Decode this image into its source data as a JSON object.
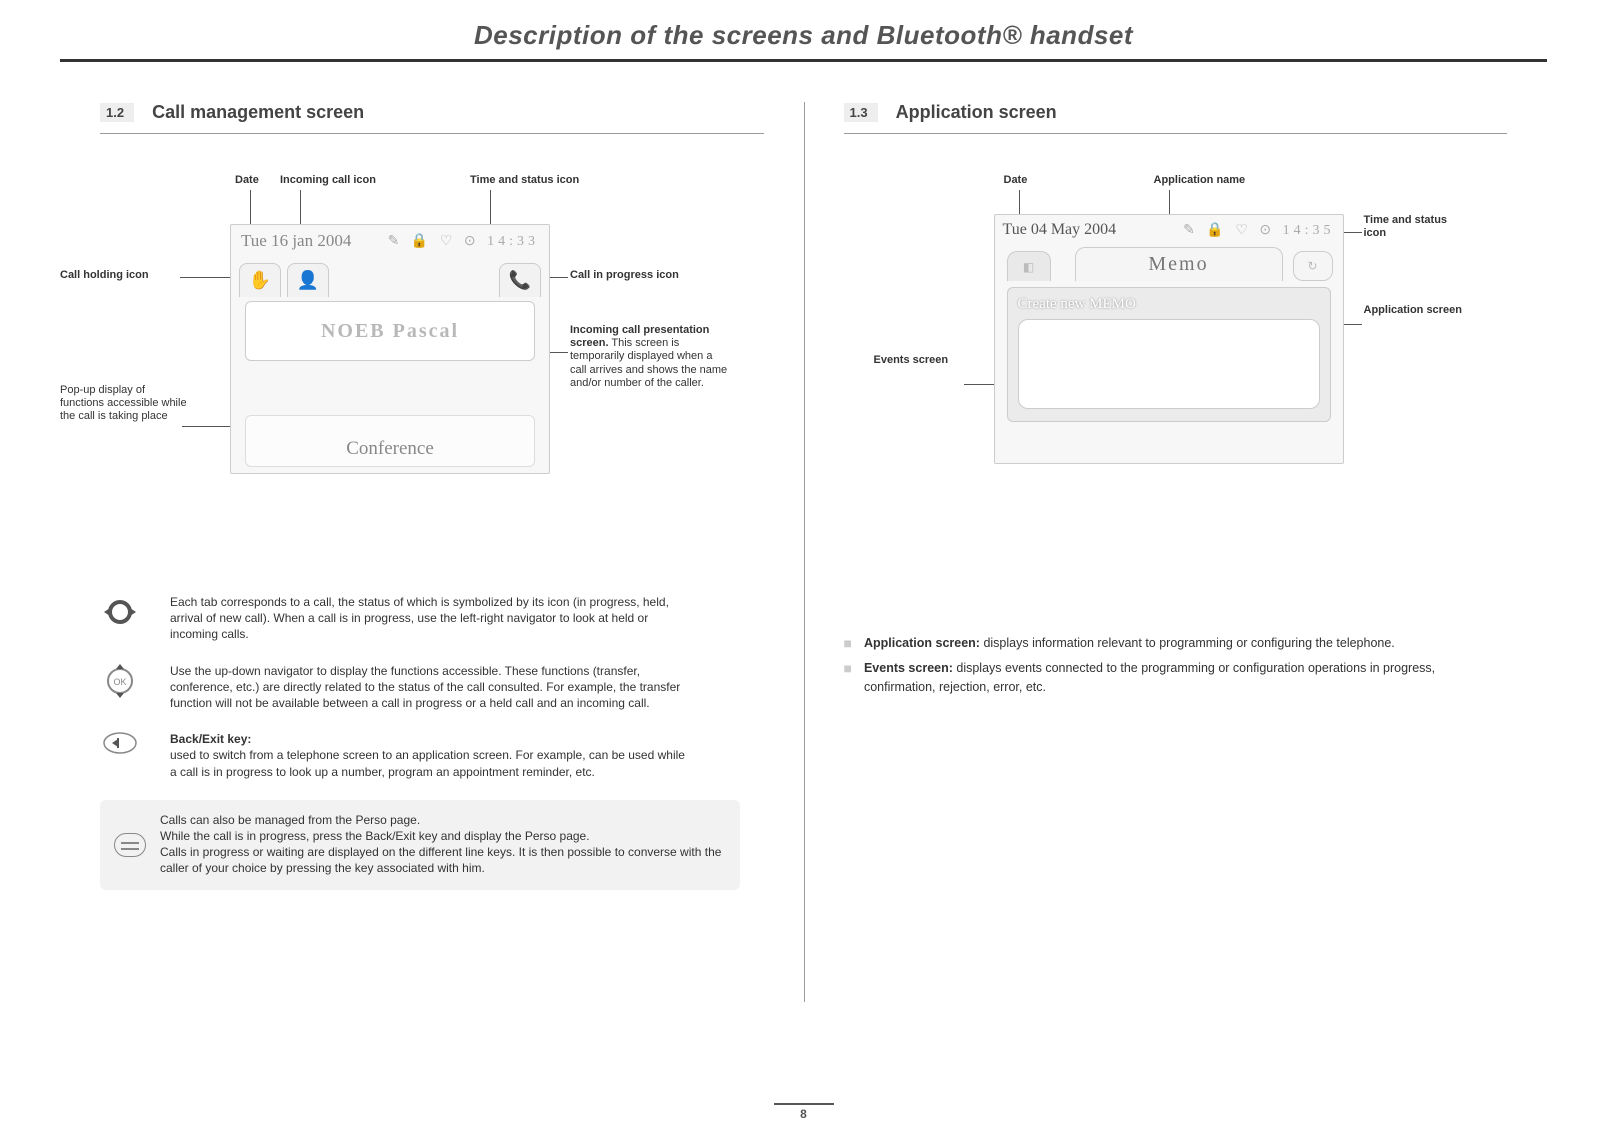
{
  "page": {
    "title": "Description of the screens and Bluetooth® handset",
    "number": "8"
  },
  "left": {
    "section_num": "1.2",
    "section_title": "Call management screen",
    "labels": {
      "date": "Date",
      "incoming_icon": "Incoming call icon",
      "time_status": "Time and status icon",
      "hold_icon": "Call holding icon",
      "in_progress": "Call in progress icon",
      "presentation_lead": "Incoming call presenta­tion screen.",
      "presentation_body": "  This screen is temporarily displayed when a call arrives and shows the name and/or number of the caller.",
      "popup": "Pop-up display of functions accessible while the call is taking place"
    },
    "screen": {
      "date": "Tue 16 jan 2004",
      "time": "14:33",
      "caller": "NOEB Pascal",
      "footer": "Conference"
    },
    "help": {
      "row1": "Each tab corresponds to a call, the status of which is symbolized by its icon (in progress, held, arrival of new call). When a call is in progress, use the left-right navigator to look at held or incoming calls.",
      "row2": "Use the up-down navigator to display the functions accessible. These functions (transfer, conference, etc.) are directly related to the status of the call consulted. For example, the transfer function will not be available between a call in progress or a held call and an incoming call.",
      "row3_lead": "Back/Exit key:",
      "row3_body": "used to switch from a telephone screen to an application screen. For example, can be used while a call is in pro­gress to look up a number, program an appointment reminder, etc.",
      "note": "Calls can also be managed from the Perso page.\nWhile the call is in progress, press the Back/Exit key and display the Perso page.\nCalls in progress or waiting are displayed on the different line keys. It is then possible to converse with the caller of your choice by pressing the key associated with him."
    }
  },
  "right": {
    "section_num": "1.3",
    "section_title": "Application screen",
    "labels": {
      "date": "Date",
      "app_name": "Application name",
      "time_status": "Time and status icon",
      "app_screen": "Application screen",
      "events": "Events screen"
    },
    "screen": {
      "date": "Tue 04 May 2004",
      "time": "14:35",
      "app_title": "Memo",
      "body_title": "Create new MEMO"
    },
    "bullets": {
      "b1_lead": "Application screen:",
      "b1_body": " displays information relevant to programming or configuring the telephone.",
      "b2_lead": "Events screen:",
      "b2_body": " displays events connected to the programming or configuration operations in progress, confirmation, rejection, error, etc."
    }
  }
}
